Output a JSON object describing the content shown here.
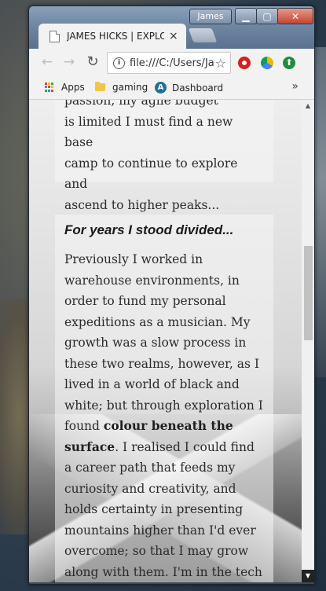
{
  "window": {
    "user": "James",
    "tab_title": "JAMES HICKS | EXPLORER",
    "tab_close": "×",
    "min_glyph": "▁",
    "max_glyph": "▢",
    "close_glyph": "✕"
  },
  "toolbar": {
    "back_glyph": "←",
    "forward_glyph": "→",
    "reload_glyph": "↻",
    "url": "file:///C:/Users/James/",
    "info_glyph": "i",
    "star_glyph": "☆",
    "ext3_glyph": "⬆"
  },
  "bookmarks": {
    "apps": "Apps",
    "gaming": "gaming",
    "dashboard": "Dashboard",
    "dashboard_icon_glyph": "A",
    "more": "»",
    "apps_colors": [
      "#ea4335",
      "#fbbc05",
      "#34a853",
      "#4285f4",
      "#ea4335",
      "#fbbc05",
      "#34a853",
      "#4285f4",
      "#ea4335"
    ]
  },
  "content": {
    "card1_lines": [
      "passion, my agile budget",
      "is limited I must find a new base",
      "camp to continue to explore and",
      "ascend to higher peaks..."
    ],
    "card2_heading": "For years I stood divided...",
    "card2_p1": "Previously I worked in warehouse environments, in order to fund my personal expeditions as a musician. My growth was a slow process in these two realms, however, as I lived in a world of black and white; but through exploration I found ",
    "card2_bold": "colour beneath the surface",
    "card2_p2": ". I realised I could find a career path that feeds my curiosity and creativity, and holds certainty in presenting mountains higher than I'd ever overcome; so that I may grow along with them. I'm in the tech"
  },
  "scrollbar": {
    "up_glyph": "▲",
    "down_glyph": "▼"
  }
}
